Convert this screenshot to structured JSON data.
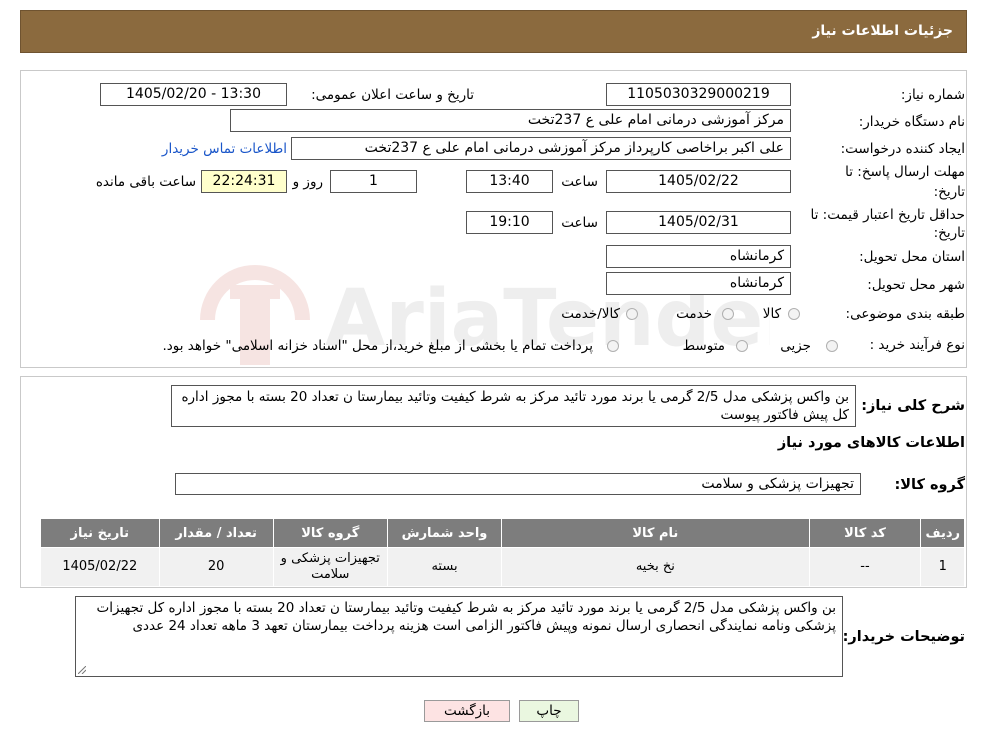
{
  "header": {
    "title": "جزئیات اطلاعات نیاز"
  },
  "watermark": {
    "text": "AriaTender.neT"
  },
  "fields": {
    "need_number_label": "شماره نیاز:",
    "need_number": "1105030329000219",
    "announce_label": "تاریخ و ساعت اعلان عمومی:",
    "announce_value": "1405/02/20 - 13:30",
    "buyer_org_label": "نام دستگاه خریدار:",
    "buyer_org": "مرکز آموزشی درمانی امام علی ع 237تخت",
    "creator_label": "ایجاد کننده درخواست:",
    "creator": "علی اکبر براخاصی کارپرداز  مرکز آموزشی درمانی امام علی ع 237تخت",
    "contact_link": "اطلاعات تماس خریدار",
    "deadline_label_1": "مهلت ارسال پاسخ: تا",
    "deadline_label_2": "تاریخ:",
    "deadline_date": "1405/02/22",
    "time_label": "ساعت",
    "deadline_time": "13:40",
    "days_value": "1",
    "days_label": "روز و",
    "remaining_time": "22:24:31",
    "remaining_label": "ساعت باقی مانده",
    "validity_label_1": "حداقل تاریخ اعتبار قیمت: تا",
    "validity_label_2": "تاریخ:",
    "validity_date": "1405/02/31",
    "validity_time": "19:10",
    "province_label": "استان محل تحویل:",
    "province": "کرمانشاه",
    "city_label": "شهر محل تحویل:",
    "city": "کرمانشاه",
    "category_label": "طبقه بندی موضوعی:",
    "category_options": [
      "کالا",
      "خدمت",
      "کالا/خدمت"
    ],
    "process_label": "نوع فرآیند خرید :",
    "process_options": [
      "جزیی",
      "متوسط"
    ],
    "payment_note": "پرداخت تمام یا بخشی از مبلغ خرید،از محل \"اسناد خزانه اسلامی\" خواهد بود."
  },
  "summary": {
    "label": "شرح کلی نیاز:",
    "text": "بن واکس پزشکی مدل 2/5 گرمی   یا برند مورد تائید مرکز به شرط کیفیت وتائید بیمارستا ن تعداد 20 بسته با مجوز اداره کل پیش فاکتور پیوست"
  },
  "goods": {
    "section_title": "اطلاعات کالاهای مورد نیاز",
    "group_label": "گروه کالا:",
    "group_value": "تجهیزات پزشکی و سلامت"
  },
  "table": {
    "headers": [
      "ردیف",
      "کد کالا",
      "نام کالا",
      "واحد شمارش",
      "گروه کالا",
      "تعداد / مقدار",
      "تاریخ نیاز"
    ],
    "rows": [
      [
        "1",
        "--",
        "نخ بخیه",
        "بسته",
        "تجهیزات پزشکی و سلامت",
        "20",
        "1405/02/22"
      ]
    ]
  },
  "buyer_notes": {
    "label": "توضیحات خریدار:",
    "text": "بن واکس پزشکی مدل 2/5 گرمی   یا برند مورد تائید مرکز به شرط کیفیت وتائید بیمارستا ن تعداد 20 بسته با مجوز اداره کل تجهیزات پزشکی ونامه نمایندگی انحصاری ارسال نمونه وپیش فاکتور الزامی است هزینه پرداخت بیمارستان تعهد 3 ماهه تعداد 24 عددی"
  },
  "buttons": {
    "print": "چاپ",
    "back": "بازگشت"
  },
  "colors": {
    "header_bg": "#8b6a3e",
    "table_header_bg": "#7d7d7d",
    "print_bg": "#eaf7e0",
    "back_bg": "#fde3e3",
    "link": "#1a56c9"
  }
}
